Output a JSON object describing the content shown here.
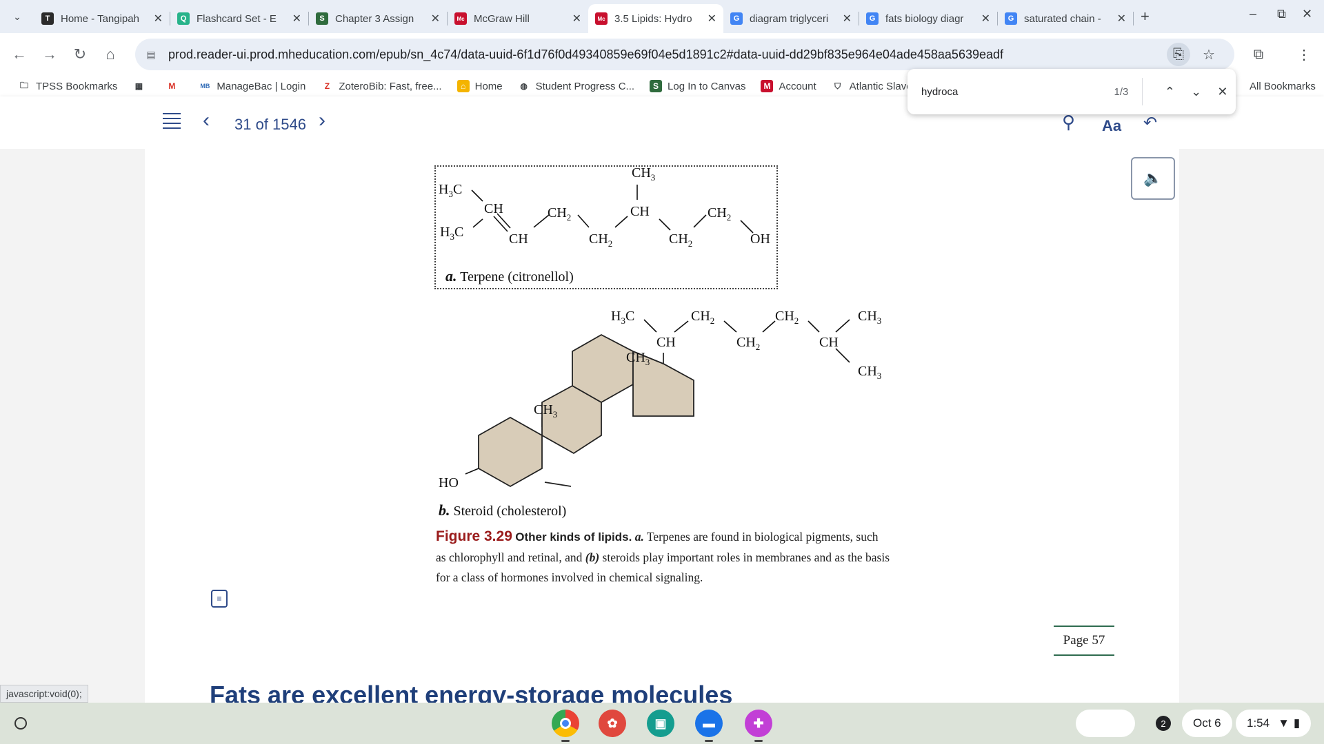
{
  "tabs": [
    {
      "title": "Home - Tangipah",
      "favicon": "T",
      "color": "#2b2b2b"
    },
    {
      "title": "Flashcard Set - E",
      "favicon": "Q",
      "color": "#27b38a"
    },
    {
      "title": "Chapter 3 Assign",
      "favicon": "S",
      "color": "#2f6b3d"
    },
    {
      "title": "McGraw Hill",
      "favicon": "Mc",
      "color": "#c8102e"
    },
    {
      "title": "3.5 Lipids: Hydro",
      "favicon": "Mc",
      "color": "#c8102e",
      "active": true
    },
    {
      "title": "diagram triglyceri",
      "favicon": "G",
      "color": "#4285f4"
    },
    {
      "title": "fats biology diagr",
      "favicon": "G",
      "color": "#4285f4"
    },
    {
      "title": "saturated chain -",
      "favicon": "G",
      "color": "#4285f4"
    }
  ],
  "omnibox": {
    "url": "prod.reader-ui.prod.mheducation.com/epub/sn_4c74/data-uuid-6f1d76f0d49340859e69f04e5d1891c2#data-uuid-dd29bf835e964e04ade458aa5639eadf"
  },
  "bookmarks": [
    {
      "label": "TPSS Bookmarks",
      "icon": "folder-icon"
    },
    {
      "label": "",
      "icon": "apps-grid-icon"
    },
    {
      "label": "",
      "icon": "gmail-icon"
    },
    {
      "label": "ManageBac | Login",
      "icon": "MB"
    },
    {
      "label": "ZoteroBib: Fast, free...",
      "icon": "Z"
    },
    {
      "label": "Home",
      "icon": "home-bookmark-icon"
    },
    {
      "label": "Student Progress C...",
      "icon": "globe-icon"
    },
    {
      "label": "Log In to Canvas",
      "icon": "S"
    },
    {
      "label": "Account",
      "icon": "M"
    },
    {
      "label": "Atlantic Slave",
      "icon": "shield-icon"
    }
  ],
  "all_bookmarks": "All Bookmarks",
  "findbar": {
    "query": "hydroca",
    "count": "1/3"
  },
  "reader": {
    "page_position": "31 of 1546"
  },
  "figure": {
    "terpene": {
      "atoms": [
        "CH",
        "CH",
        "CH",
        "CH",
        "OH"
      ],
      "h3c_label": "H",
      "ch3_label": "CH",
      "ch2_label": "CH",
      "label_letter": "a.",
      "label_text": "Terpene (citronellol)"
    },
    "steroid": {
      "ho": "HO",
      "label_letter": "b.",
      "label_text": "Steroid (cholesterol)"
    },
    "caption_num": "Figure 3.29",
    "caption_title": "Other kinds of lipids.",
    "caption_a": "a.",
    "caption_a_text": "Terpenes are found in biological pigments, such as chlorophyll and retinal, and",
    "caption_b": "(b)",
    "caption_b_text": "steroids play important roles in membranes and as the basis for a class of hormones involved in chemical signaling."
  },
  "page_label": "Page 57",
  "section_heading": "Fats are excellent energy-storage molecules",
  "status_link": "javascript:void(0);",
  "shelf": {
    "notification_count": "2",
    "date": "Oct 6",
    "time": "1:54"
  },
  "colors": {
    "accent": "#2f4b8a",
    "figure_red": "#9a1b1b",
    "ring_fill": "#d8ccb8"
  }
}
